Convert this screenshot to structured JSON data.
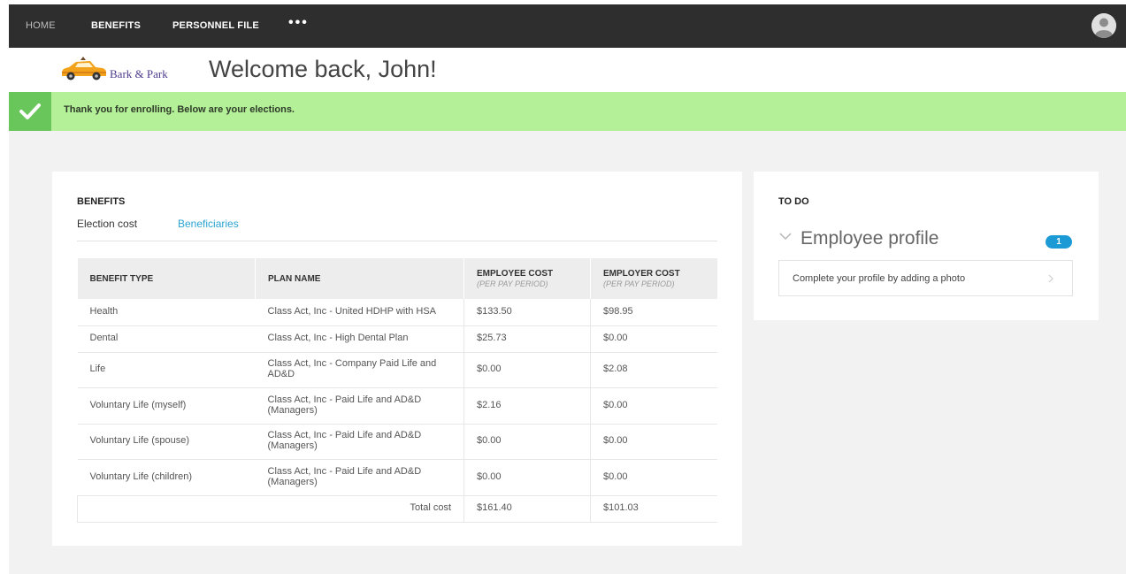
{
  "nav": {
    "home": "HOME",
    "benefits": "BENEFITS",
    "personnel_file": "PERSONNEL FILE",
    "more": "•••",
    "avatar_icon": "user-avatar-icon"
  },
  "header": {
    "logo_text": "Bark & Park",
    "welcome": "Welcome back, John!"
  },
  "banner": {
    "icon": "checkmark-icon",
    "message": "Thank you for enrolling. Below are your elections.",
    "color": "#b3f097",
    "icon_bg": "#69c65a"
  },
  "benefits": {
    "title": "BENEFITS",
    "tabs": [
      "Election cost",
      "Beneficiaries"
    ],
    "columns": {
      "type": "BENEFIT TYPE",
      "plan": "PLAN NAME",
      "employee_cost": "EMPLOYEE COST",
      "employee_cost_sub": "(PER PAY PERIOD)",
      "employer_cost": "EMPLOYER COST",
      "employer_cost_sub": "(PER PAY PERIOD)"
    },
    "rows": [
      {
        "type": "Health",
        "plan": "Class Act, Inc - United HDHP with HSA",
        "employee_cost": "$133.50",
        "employer_cost": "$98.95"
      },
      {
        "type": "Dental",
        "plan": "Class Act, Inc - High Dental Plan",
        "employee_cost": "$25.73",
        "employer_cost": "$0.00"
      },
      {
        "type": "Life",
        "plan": "Class Act, Inc - Company Paid Life and AD&D",
        "employee_cost": "$0.00",
        "employer_cost": "$2.08"
      },
      {
        "type": "Voluntary Life (myself)",
        "plan": "Class Act, Inc - Paid Life and AD&D (Managers)",
        "employee_cost": "$2.16",
        "employer_cost": "$0.00"
      },
      {
        "type": "Voluntary Life (spouse)",
        "plan": "Class Act, Inc - Paid Life and AD&D (Managers)",
        "employee_cost": "$0.00",
        "employer_cost": "$0.00"
      },
      {
        "type": "Voluntary Life (children)",
        "plan": "Class Act, Inc - Paid Life and AD&D (Managers)",
        "employee_cost": "$0.00",
        "employer_cost": "$0.00"
      }
    ],
    "total": {
      "label": "Total cost",
      "employee_cost": "$161.40",
      "employer_cost": "$101.03"
    },
    "accent_color": "#2aa3d2"
  },
  "todo": {
    "title": "TO DO",
    "section_title": "Employee profile",
    "count": "1",
    "count_color": "#1b9ad6",
    "task": "Complete your profile by adding a photo"
  }
}
